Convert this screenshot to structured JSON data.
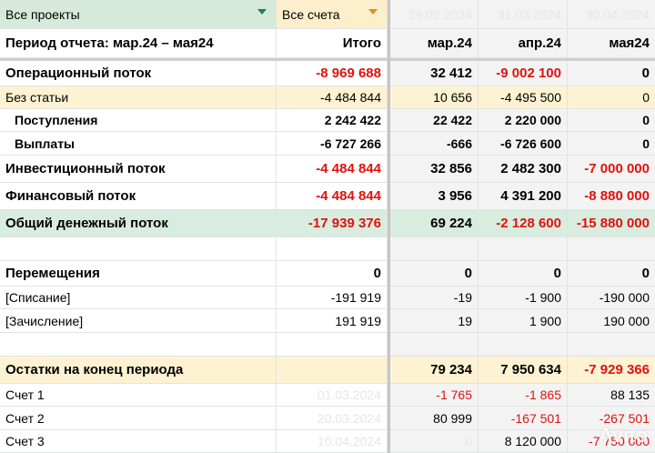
{
  "filters": {
    "projects": "Все проекты",
    "accounts": "Все счета"
  },
  "header_dates": [
    "29.02.2024",
    "31.03.2024",
    "30.04.2024"
  ],
  "period": {
    "label": "Период отчета: мар.24 – мая24",
    "total": "Итого",
    "m1": "мар.24",
    "m2": "апр.24",
    "m3": "мая24"
  },
  "rows": {
    "op": [
      "Операционный поток",
      "-8 969 688",
      "32 412",
      "-9 002 100",
      "0"
    ],
    "nocat": [
      "Без статьи",
      "-4 484 844",
      "10 656",
      "-4 495 500",
      "0"
    ],
    "income": [
      "Поступления",
      "2 242 422",
      "22 422",
      "2 220 000",
      "0"
    ],
    "payments": [
      "Выплаты",
      "-6 727 266",
      "-666",
      "-6 726 600",
      "0"
    ],
    "invest": [
      "Инвестиционный поток",
      "-4 484 844",
      "32 856",
      "2 482 300",
      "-7 000 000"
    ],
    "fin": [
      "Финансовый поток",
      "-4 484 844",
      "3 956",
      "4 391 200",
      "-8 880 000"
    ],
    "total": [
      "Общий денежный поток",
      "-17 939 376",
      "69 224",
      "-2 128 600",
      "-15 880 000"
    ],
    "moves": [
      "Перемещения",
      "0",
      "0",
      "0",
      "0"
    ],
    "writeoff": [
      "[Списание]",
      "-191 919",
      "-19",
      "-1 900",
      "-190 000"
    ],
    "credit": [
      "[Зачисление]",
      "191 919",
      "19",
      "1 900",
      "190 000"
    ],
    "balance": [
      "Остатки на конец периода",
      "",
      "79 234",
      "7 950 634",
      "-7 929 366"
    ],
    "acc1": [
      "Счет 1",
      "01.03.2024",
      "-1 765",
      "-1 865",
      "88 135"
    ],
    "acc2": [
      "Счет 2",
      "20.03.2024",
      "80 999",
      "-167 501",
      "-267 501"
    ],
    "acc3": [
      "Счет 3",
      "10.04.2024",
      "0",
      "8 120 000",
      "-7 750 000"
    ]
  },
  "watermark": "Avito",
  "colors": {
    "red": "#e0120e",
    "green_row": "#d8ecdf",
    "yellow_row": "#fdf3d3",
    "gray_col": "#f3f3f3"
  }
}
